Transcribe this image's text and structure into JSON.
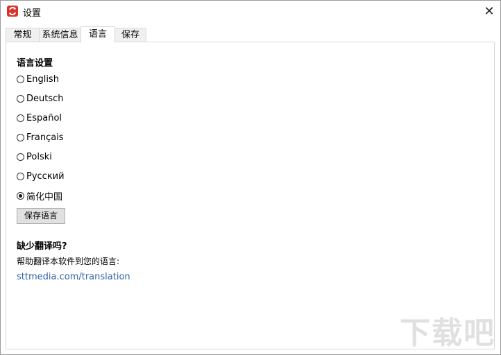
{
  "window": {
    "title": "设置",
    "close_glyph": "✕"
  },
  "tabs": [
    {
      "label": "常规",
      "active": false
    },
    {
      "label": "系统信息",
      "active": false
    },
    {
      "label": "语言",
      "active": true
    },
    {
      "label": "保存",
      "active": false
    }
  ],
  "language": {
    "section_title": "语言设置",
    "options": [
      {
        "label": "English",
        "selected": false
      },
      {
        "label": "Deutsch",
        "selected": false
      },
      {
        "label": "Español",
        "selected": false
      },
      {
        "label": "Français",
        "selected": false
      },
      {
        "label": "Polski",
        "selected": false
      },
      {
        "label": "Русский",
        "selected": false
      },
      {
        "label": "简化中国",
        "selected": true
      }
    ],
    "save_button": "保存语言"
  },
  "translation": {
    "title": "缺少翻译吗?",
    "help_text": "帮助翻译本软件到您的语言:",
    "link": "sttmedia.com/translation"
  },
  "watermark": {
    "text": "下载吧"
  },
  "colors": {
    "app_icon": "#d9322b",
    "link": "#3163a8"
  }
}
